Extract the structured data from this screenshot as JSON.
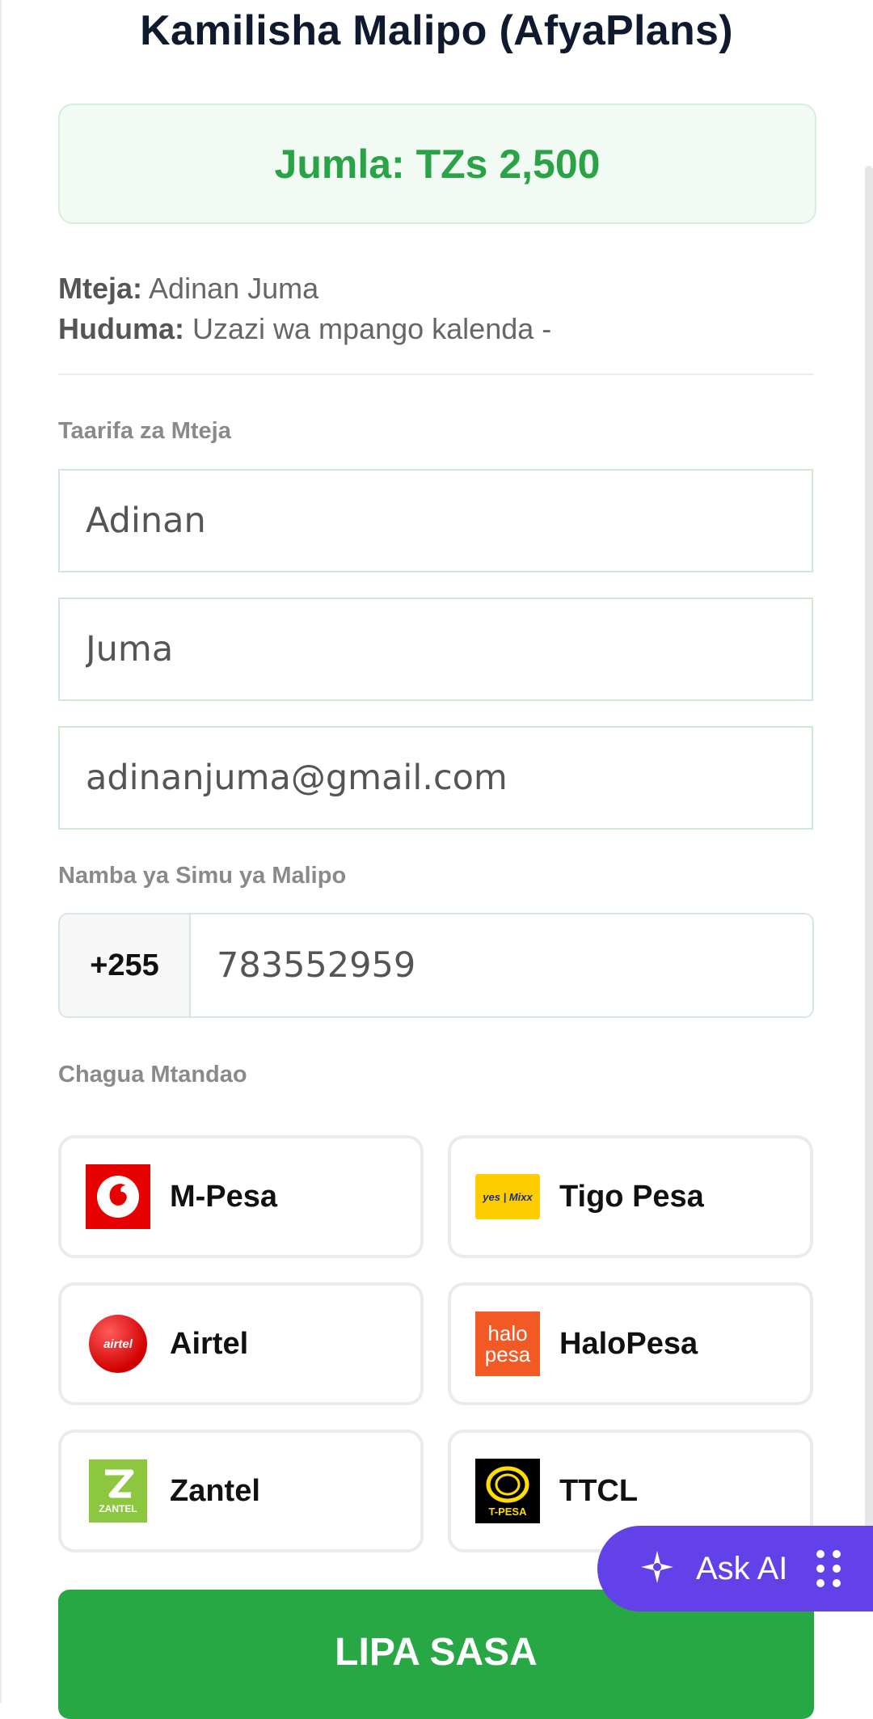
{
  "page": {
    "title": "Kamilisha Malipo (AfyaPlans)"
  },
  "summary": {
    "total": "Jumla: TZs 2,500"
  },
  "details": {
    "customer_label": "Mteja:",
    "customer_value": "Adinan Juma",
    "service_label": "Huduma:",
    "service_value": "Uzazi wa mpango kalenda -"
  },
  "customer_section": {
    "label": "Taarifa za Mteja",
    "first_name": "Adinan",
    "last_name": "Juma",
    "email": "adinanjuma@gmail.com"
  },
  "phone_section": {
    "label": "Namba ya Simu ya Malipo",
    "prefix": "+255",
    "number": "783552959"
  },
  "network_section": {
    "label": "Chagua Mtandao",
    "networks": [
      {
        "name": "M-Pesa",
        "icon": "vodacom-mpesa-logo",
        "color": "#e60000"
      },
      {
        "name": "Tigo Pesa",
        "icon": "yas-mixx-logo",
        "color": "#ffcc00"
      },
      {
        "name": "Airtel",
        "icon": "airtel-money-logo",
        "color": "#e40000"
      },
      {
        "name": "HaloPesa",
        "icon": "halopesa-logo",
        "color": "#f15a24"
      },
      {
        "name": "Zantel",
        "icon": "zantel-logo",
        "color": "#8dc63f"
      },
      {
        "name": "TTCL",
        "icon": "ttcl-tpesa-logo",
        "color": "#ffdd00"
      }
    ],
    "logo_text": {
      "tigo": "yes | Mixx",
      "airtel": "airtel",
      "halopesa_top": "halo",
      "halopesa_bottom": "pesa",
      "zantel": "ZANTEL",
      "ttcl": "T-PESA"
    }
  },
  "actions": {
    "pay": "LIPA SASA"
  },
  "assistant": {
    "label": "Ask AI",
    "icon": "sparkle-ai-icon",
    "color": "#6241e8"
  },
  "theme": {
    "accent": "#28a745",
    "title_color": "#0f1a2e"
  }
}
